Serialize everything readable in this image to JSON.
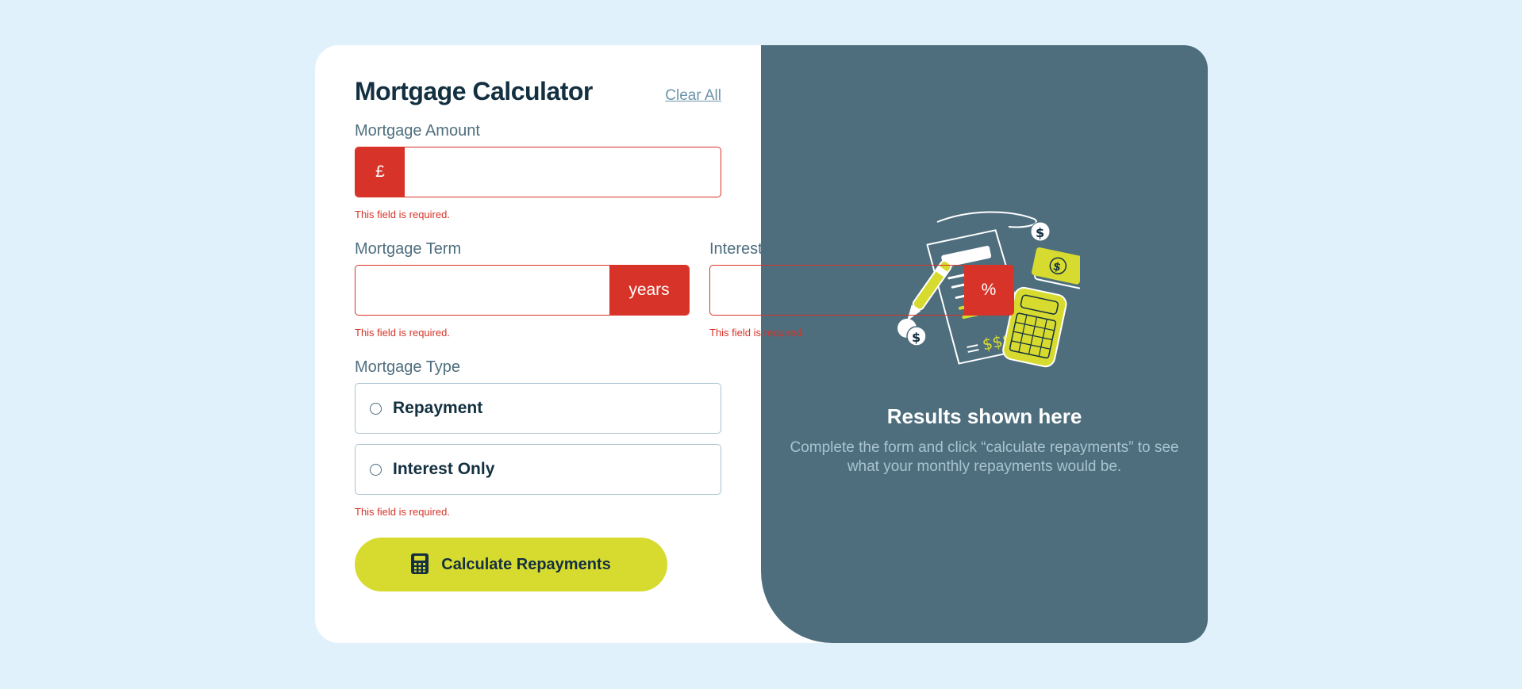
{
  "form": {
    "title": "Mortgage Calculator",
    "clear_all": "Clear All",
    "amount": {
      "label": "Mortgage Amount",
      "prefix": "£",
      "value": "",
      "error": "This field is required."
    },
    "term": {
      "label": "Mortgage Term",
      "suffix": "years",
      "value": "",
      "error": "This field is required."
    },
    "rate": {
      "label": "Interest Rate",
      "suffix": "%",
      "value": "",
      "error": "This field is required."
    },
    "type": {
      "label": "Mortgage Type",
      "options": [
        {
          "label": "Repayment",
          "selected": false
        },
        {
          "label": "Interest Only",
          "selected": false
        }
      ],
      "error": "This field is required."
    },
    "submit_label": "Calculate Repayments"
  },
  "results": {
    "title": "Results shown here",
    "description": "Complete the form and click “calculate repayments” to see what your monthly repayments would be.",
    "illustration_icon": "empty-results-illustration-icon"
  },
  "colors": {
    "background": "#e0f1fc",
    "panel_dark": "#4e6e7e",
    "error": "#d73328",
    "lime": "#d8db2f",
    "navy": "#133041"
  }
}
